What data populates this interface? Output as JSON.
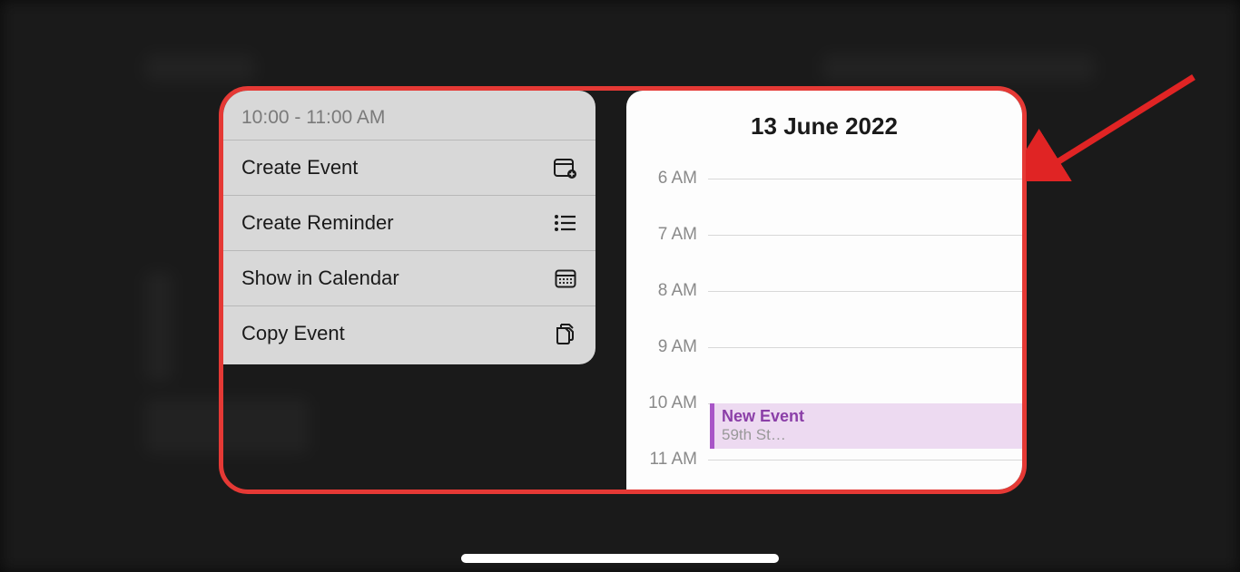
{
  "menu": {
    "time_range": "10:00 - 11:00 AM",
    "items": [
      {
        "label": "Create Event",
        "icon": "calendar-plus-icon"
      },
      {
        "label": "Create Reminder",
        "icon": "list-icon"
      },
      {
        "label": "Show in Calendar",
        "icon": "calendar-icon"
      },
      {
        "label": "Copy Event",
        "icon": "copy-icon"
      }
    ]
  },
  "calendar": {
    "date_title": "13 June 2022",
    "hours": [
      "6 AM",
      "7 AM",
      "8 AM",
      "9 AM",
      "10 AM",
      "11 AM"
    ],
    "event": {
      "title": "New Event",
      "location": "59th St…"
    }
  },
  "colors": {
    "highlight_border": "#e53935",
    "event_bg": "#eddaf1",
    "event_accent": "#a855c7"
  }
}
